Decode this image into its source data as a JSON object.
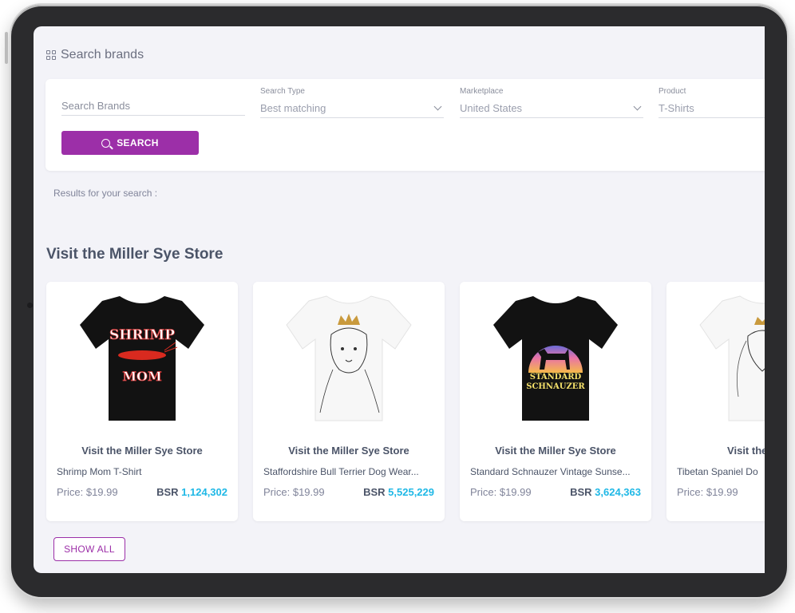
{
  "header": {
    "title": "Search brands",
    "icon": "grid-icon"
  },
  "search": {
    "brands_placeholder": "Search Brands",
    "type_label": "Search Type",
    "type_value": "Best matching",
    "marketplace_label": "Marketplace",
    "marketplace_value": "United States",
    "product_label": "Product",
    "product_value": "T-Shirts",
    "button_label": "SEARCH"
  },
  "results_text": "Results for your search :",
  "section_title": "Visit the Miller Sye Store",
  "cards": [
    {
      "store": "Visit the Miller Sye Store",
      "name": "Shrimp Mom T-Shirt",
      "price": "Price: $19.99",
      "bsr_label": "BSR",
      "bsr_value": "1,124,302",
      "shirt_color": "#111111"
    },
    {
      "store": "Visit the Miller Sye Store",
      "name": "Staffordshire Bull Terrier Dog Wear...",
      "price": "Price: $19.99",
      "bsr_label": "BSR",
      "bsr_value": "5,525,229",
      "shirt_color": "#f6f6f6"
    },
    {
      "store": "Visit the Miller Sye Store",
      "name": "Standard Schnauzer Vintage Sunse...",
      "price": "Price: $19.99",
      "bsr_label": "BSR",
      "bsr_value": "3,624,363",
      "shirt_color": "#111111"
    },
    {
      "store": "Visit the Miller",
      "name": "Tibetan Spaniel Do",
      "price": "Price: $19.99",
      "bsr_label": "",
      "bsr_value": "",
      "shirt_color": "#f6f6f6"
    }
  ],
  "graphics": {
    "shrimp_text_top": "SHRIMP",
    "shrimp_text_bottom": "MOM",
    "schnauzer_text_1": "STANDARD",
    "schnauzer_text_2": "SCHNAUZER"
  },
  "show_all_label": "SHOW ALL",
  "colors": {
    "accent": "#9c2fa8",
    "bsr": "#1fb8e6",
    "text": "#4b5468"
  }
}
